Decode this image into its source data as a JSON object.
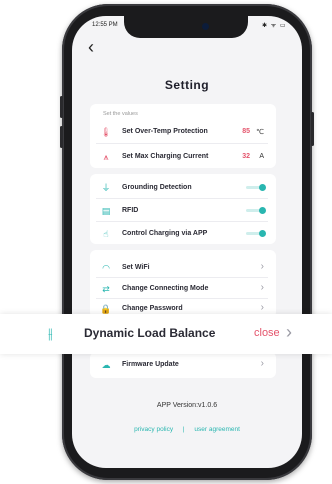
{
  "status_bar": {
    "time": "12:55 PM",
    "icons": "✱ ᯤ ▭"
  },
  "page": {
    "title": "Setting",
    "back_icon": "chevron-left-icon"
  },
  "section_label": "Set the values",
  "values": [
    {
      "label": "Set Over-Temp Protection",
      "value": "85",
      "unit": "℃",
      "icon": "thermometer-icon",
      "color": "#e4546c"
    },
    {
      "label": "Set Max Charging Current",
      "value": "32",
      "unit": "A",
      "icon": "current-icon",
      "color": "#e4546c"
    }
  ],
  "toggles": [
    {
      "label": "Grounding Detection",
      "on": true,
      "icon": "grounding-icon"
    },
    {
      "label": "RFID",
      "on": true,
      "icon": "rfid-icon"
    },
    {
      "label": "Control Charging via APP",
      "on": true,
      "icon": "app-control-icon"
    }
  ],
  "menu": [
    {
      "label": "Set WiFi",
      "icon": "wifi-icon"
    },
    {
      "label": "Change Connecting Mode",
      "icon": "connection-mode-icon"
    },
    {
      "label": "Change Password",
      "icon": "lock-icon"
    }
  ],
  "dynamic_load": {
    "label": "Dynamic Load Balance",
    "status": "close",
    "icon": "sliders-icon"
  },
  "firmware": {
    "label": "Firmware Update",
    "icon": "cloud-upload-icon"
  },
  "footer": {
    "version": "APP Version:v1.0.6",
    "privacy": "privacy policy",
    "separator": "|",
    "agreement": "user agreement"
  },
  "colors": {
    "accent": "#29b6b0",
    "value": "#e4546c"
  }
}
